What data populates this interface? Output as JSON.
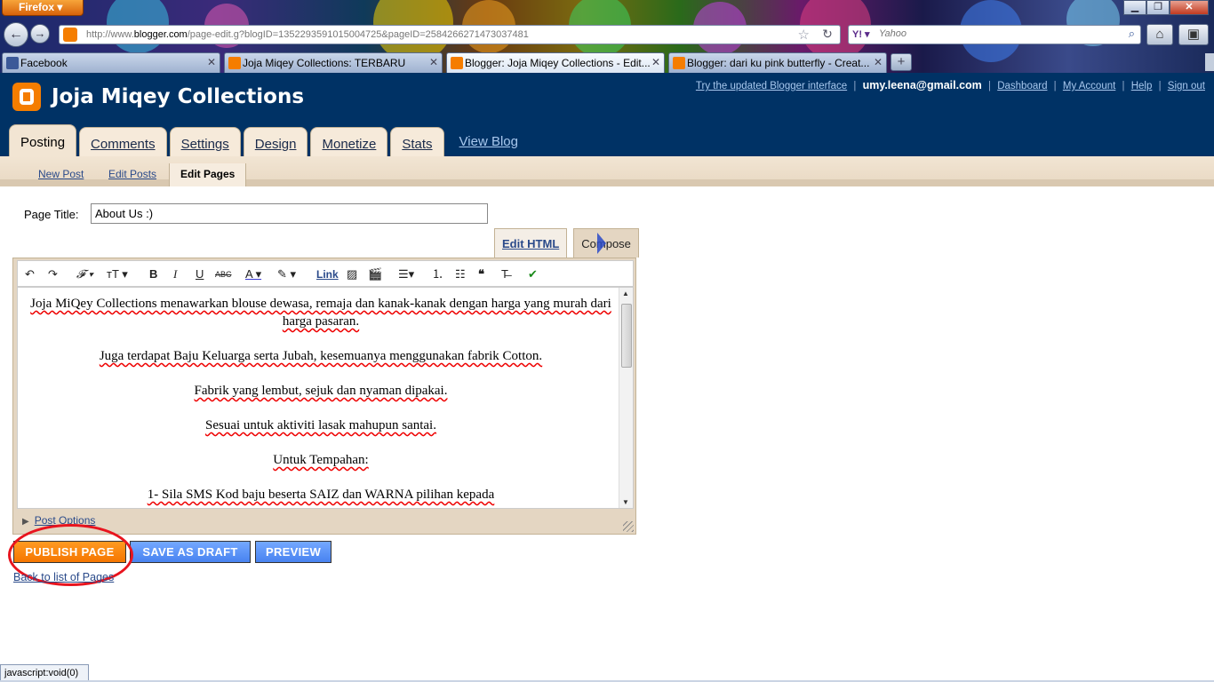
{
  "browser": {
    "app_button": "Firefox",
    "url_prefix": "http://www.",
    "url_host": "blogger.com",
    "url_path": "/page-edit.g?blogID=1352293591015004725&pageID=2584266271473037481",
    "search_engine": "Y!",
    "search_placeholder": "Yahoo",
    "tabs": [
      {
        "label": "Facebook",
        "active": false
      },
      {
        "label": "Joja Miqey Collections: TERBARU",
        "active": false
      },
      {
        "label": "Blogger: Joja Miqey Collections - Edit...",
        "active": true
      },
      {
        "label": "Blogger: dari ku pink butterfly - Creat...",
        "active": false
      }
    ],
    "status_text": "javascript:void(0)"
  },
  "header": {
    "blog_title": "Joja Miqey Collections",
    "links": {
      "try_updated": "Try the updated Blogger interface",
      "email": "umy.leena@gmail.com",
      "dashboard": "Dashboard",
      "my_account": "My Account",
      "help": "Help",
      "sign_out": "Sign out"
    },
    "tabs": [
      "Posting",
      "Comments",
      "Settings",
      "Design",
      "Monetize",
      "Stats"
    ],
    "view_blog": "View Blog"
  },
  "subnav": {
    "new_post": "New Post",
    "edit_posts": "Edit Posts",
    "edit_pages": "Edit Pages"
  },
  "editor": {
    "page_title_label": "Page Title:",
    "page_title_value": "About Us :)",
    "mode_edit_html": "Edit HTML",
    "mode_compose": "Compose",
    "toolbar_link": "Link",
    "content_lines": [
      "Joja MiQey Collections menawarkan blouse dewasa, remaja dan kanak-kanak dengan harga yang murah dari harga pasaran.",
      "Juga terdapat Baju Keluarga serta Jubah, kesemuanya menggunakan fabrik Cotton.",
      "Fabrik yang lembut, sejuk dan nyaman dipakai.",
      "Sesuai untuk aktiviti lasak mahupun santai.",
      "Untuk Tempahan:",
      "1- Sila SMS Kod baju beserta SAIZ dan WARNA pilihan kepada"
    ],
    "post_options": "Post Options"
  },
  "actions": {
    "publish": "PUBLISH PAGE",
    "save_draft": "SAVE AS DRAFT",
    "preview": "PREVIEW",
    "back_link": "Back to list of Pages"
  },
  "colors": {
    "blogger_navy": "#003265",
    "blogger_orange": "#f57d00",
    "highlight_red": "#e8141e"
  }
}
